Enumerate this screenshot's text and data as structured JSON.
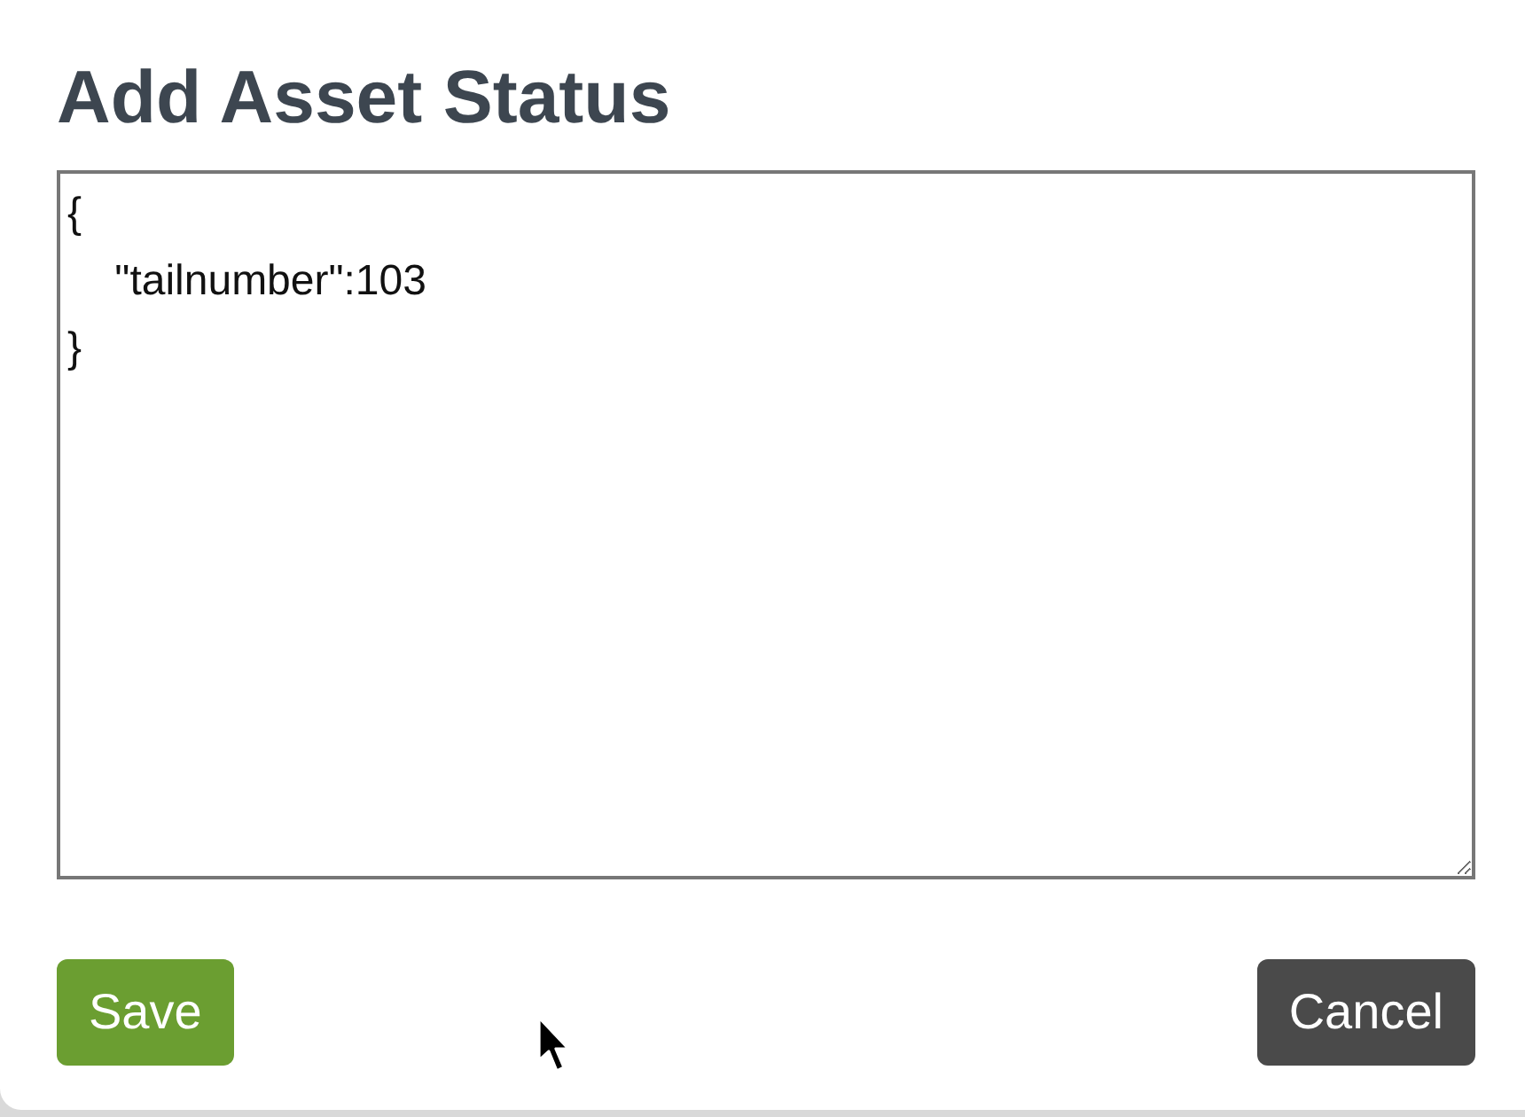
{
  "dialog": {
    "title": "Add Asset Status",
    "editor": {
      "value": "{\n    \"tailnumber\":103\n}"
    },
    "buttons": [
      {
        "kind": "primary",
        "label": "Save"
      },
      {
        "kind": "secondary",
        "label": "Cancel"
      }
    ]
  }
}
